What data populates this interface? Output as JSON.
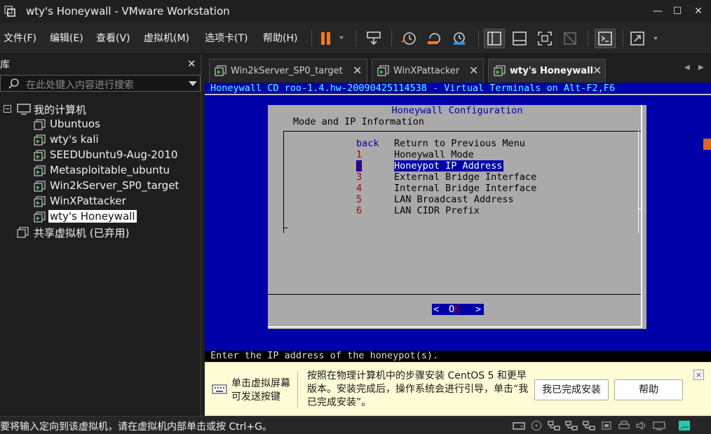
{
  "window": {
    "title": "wty's Honeywall - VMware Workstation",
    "controls": {
      "minimize": "—",
      "maximize": "☐",
      "close": "✕"
    }
  },
  "menu": [
    "文件(F)",
    "编辑(E)",
    "查看(V)",
    "虚拟机(M)",
    "选项卡(T)",
    "帮助(H)"
  ],
  "toolbar": {
    "buttons": [
      "pause-icon",
      "send-ctrl-alt-del-icon",
      "snapshot-icon",
      "revert-snapshot-icon",
      "snapshot-manager-icon",
      "library-view-icon",
      "thumbnail-view-icon",
      "full-screen-icon",
      "unity-icon",
      "console-view-icon",
      "stretch-guest-icon"
    ],
    "accent": "#f07a2a"
  },
  "library": {
    "title": "库",
    "search_placeholder": "在此处键入内容进行搜索",
    "root": "我的计算机",
    "vms": [
      "Ubuntuos",
      "wty's kali",
      "SEEDUbuntu9-Aug-2010",
      "Metasploitable_ubuntu",
      "Win2kServer_SP0_target",
      "WinXPattacker",
      "wty's Honeywall"
    ],
    "selected": "wty's Honeywall",
    "shared": "共享虚拟机 (已弃用)"
  },
  "tabs": [
    {
      "label": "Win2kServer_SP0_target",
      "active": false
    },
    {
      "label": "WinXPattacker",
      "active": false
    },
    {
      "label": "wty's Honeywall",
      "active": true
    }
  ],
  "console": {
    "header": "Honeywall CD roo-1.4.hw-20090425114538 - Virtual Terminals on Alt-F2,F6",
    "dialog_title": "Honeywall Configuration",
    "dialog_subtitle": "Mode and IP Information",
    "items": [
      {
        "tag": "back",
        "label": "Return to Previous Menu"
      },
      {
        "tag": "1",
        "label": "Honeywall Mode"
      },
      {
        "tag": "2",
        "label": "Honeypot IP Address"
      },
      {
        "tag": "3",
        "label": "External Bridge Interface"
      },
      {
        "tag": "4",
        "label": "Internal Bridge Interface"
      },
      {
        "tag": "5",
        "label": "LAN Broadcast Address"
      },
      {
        "tag": "6",
        "label": "LAN CIDR Prefix"
      }
    ],
    "selected_index": 2,
    "ok_left": "<",
    "ok_o": "O",
    "ok_k": "K",
    "ok_right": ">",
    "status": "Enter the IP address of the honeypot(s)."
  },
  "hint": {
    "click_text_1": "单击虚拟屏幕",
    "click_text_2": "可发送按键",
    "install_text": "按照在物理计算机中的步骤安装 CentOS 5 和更早版本。安装完成后，操作系统会进行引导，单击“我已完成安装”。",
    "done_button": "我已完成安装",
    "help_button": "帮助",
    "close": "×"
  },
  "statusbar": {
    "text": "要将输入定向到该虚拟机，请在虚拟机内部单击或按 Ctrl+G。",
    "devices": [
      "hard-disk-icon",
      "cd-rom-icon",
      "network-icon",
      "network-icon",
      "network-icon",
      "usb-icon",
      "printer-icon",
      "sound-icon",
      "display-icon",
      "message-icon"
    ]
  }
}
